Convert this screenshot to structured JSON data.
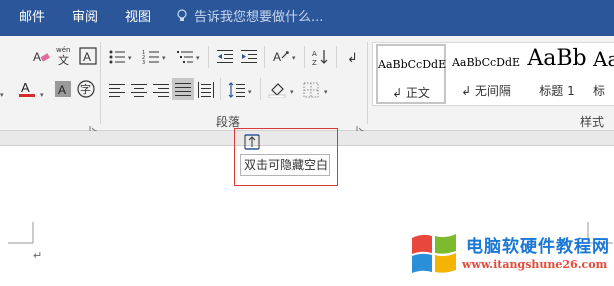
{
  "tabs": [
    {
      "label": "邮件"
    },
    {
      "label": "审阅"
    },
    {
      "label": "视图"
    }
  ],
  "tell_me": {
    "placeholder": "告诉我您想要做什么..."
  },
  "ribbon": {
    "paragraph_group_label": "段落",
    "styles_group_label": "样式",
    "font_icons": [
      "eraser-icon",
      "phonetic-guide-icon",
      "character-border-icon",
      "highlight-icon",
      "font-color-icon",
      "character-shading-icon",
      "enclose-character-icon"
    ],
    "phonetic_label": "wén",
    "phonetic_char": "文",
    "border_char": "A",
    "shading_char": "A",
    "enclose_char": "字",
    "font_color_char": "A",
    "accent_highlight": "#ffd400",
    "accent_font_color": "#d42b2b",
    "paragraph_icons": [
      "bullets-icon",
      "numbering-icon",
      "multilevel-list-icon",
      "decrease-indent-icon",
      "increase-indent-icon",
      "chinese-layout-icon",
      "sort-icon",
      "align-left-icon",
      "center-icon",
      "align-right-icon",
      "justify-icon",
      "distributed-icon",
      "line-spacing-icon",
      "shading-icon",
      "borders-icon"
    ],
    "show_marks_char": "↲"
  },
  "styles": [
    {
      "preview": "AaBbCcDdE",
      "name": "↲ 正文",
      "selected": true
    },
    {
      "preview": "AaBbCcDdE",
      "name": "↲ 无间隔",
      "selected": false
    },
    {
      "preview": "AaBb",
      "name": "标题 1",
      "selected": false
    },
    {
      "preview": "Aa",
      "name": "标",
      "selected": false
    }
  ],
  "tooltip": {
    "text": "双击可隐藏空白"
  },
  "document": {
    "paragraph_mark": "↵"
  },
  "watermark": {
    "title": "电脑软硬件教程网",
    "url": "www.it‌angshu‌ne26.com"
  },
  "colors": {
    "tab_bar": "#2b579a",
    "highlight_box": "#d93a3a",
    "watermark_title": "#1a78d4",
    "watermark_url": "#e24b3b"
  }
}
